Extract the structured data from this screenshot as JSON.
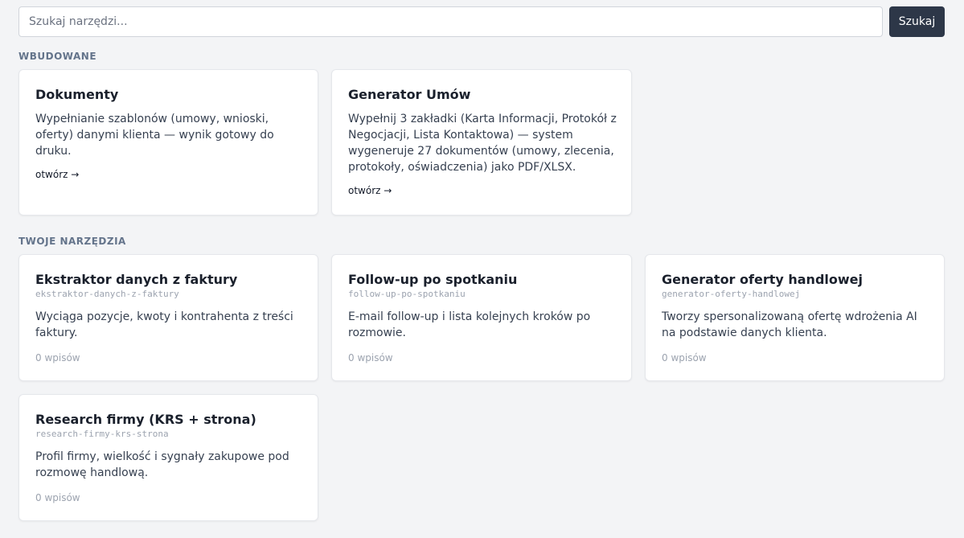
{
  "search": {
    "placeholder": "Szukaj narzędzi...",
    "value": "",
    "button_label": "Szukaj"
  },
  "builtin": {
    "heading": "WBUDOWANE",
    "cards": [
      {
        "title": "Dokumenty",
        "description": "Wypełnianie szablonów (umowy, wnioski, oferty) danymi klienta — wynik gotowy do druku.",
        "link": "otwórz →"
      },
      {
        "title": "Generator Umów",
        "description": "Wypełnij 3 zakładki (Karta Informacji, Protokół z Negocjacji, Lista Kontaktowa) — system wygeneruje 27 dokumentów (umowy, zlecenia, protokoły, oświadczenia) jako PDF/XLSX.",
        "link": "otwórz →"
      }
    ]
  },
  "tools": {
    "heading": "TWOJE NARZĘDZIA",
    "cards": [
      {
        "title": "Ekstraktor danych z faktury",
        "slug": "ekstraktor-danych-z-faktury",
        "description": "Wyciąga pozycje, kwoty i kontrahenta z treści faktury.",
        "count": "0 wpisów"
      },
      {
        "title": "Follow-up po spotkaniu",
        "slug": "follow-up-po-spotkaniu",
        "description": "E-mail follow-up i lista kolejnych kroków po rozmowie.",
        "count": "0 wpisów"
      },
      {
        "title": "Generator oferty handlowej",
        "slug": "generator-oferty-handlowej",
        "description": "Tworzy spersonalizowaną ofertę wdrożenia AI na podstawie danych klienta.",
        "count": "0 wpisów"
      },
      {
        "title": "Research firmy (KRS + strona)",
        "slug": "research-firmy-krs-strona",
        "description": "Profil firmy, wielkość i sygnały zakupowe pod rozmowę handlową.",
        "count": "0 wpisów"
      }
    ]
  }
}
